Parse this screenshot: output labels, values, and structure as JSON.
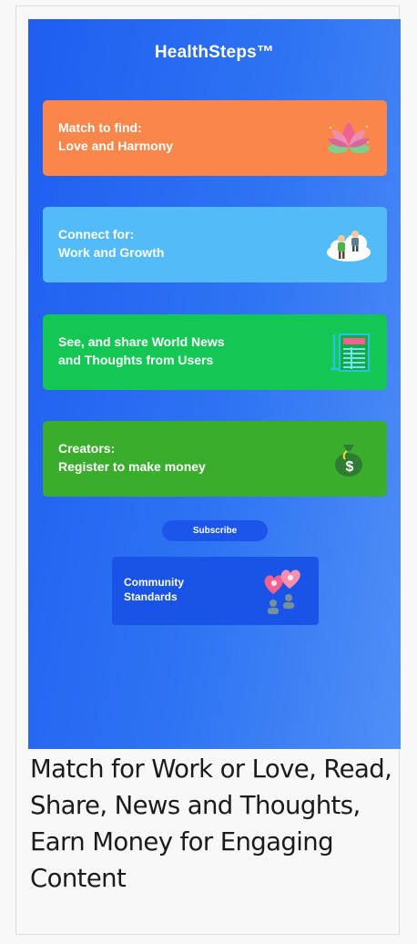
{
  "app": {
    "title": "HealthSteps™"
  },
  "cards": [
    {
      "line1": "Match to find:",
      "line2": "Love and Harmony",
      "icon": "lotus-icon",
      "color": "#f9874b"
    },
    {
      "line1": "Connect for:",
      "line2": "Work and Growth",
      "icon": "people-cloud-icon",
      "color": "#54bbf9"
    },
    {
      "line1": "See, and share World News",
      "line2": "and Thoughts from Users",
      "icon": "news-document-icon",
      "color": "#14c653"
    },
    {
      "line1": "Creators:",
      "line2": "Register to make money",
      "icon": "money-bag-icon",
      "color": "#3aae2c"
    }
  ],
  "subscribe": {
    "label": "Subscribe"
  },
  "community": {
    "line1": "Community",
    "line2": "Standards",
    "icon": "hearts-people-icon"
  },
  "caption": "Match for Work or Love, Read, Share, News and Thoughts, Earn Money for Engaging Content"
}
